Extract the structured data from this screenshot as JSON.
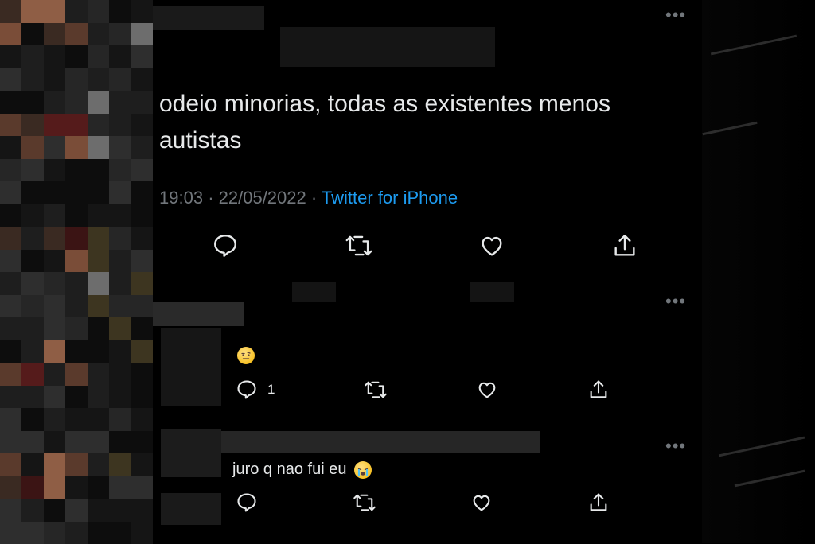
{
  "tweet": {
    "text": "odeio minorias, todas as existentes menos autistas",
    "time": "19:03",
    "date": "22/05/2022",
    "separator": "·",
    "source": "Twitter for iPhone",
    "more_label": "•••"
  },
  "replies": [
    {
      "text": "",
      "emoji": "face-with-raised-eyebrow",
      "reply_count": "1",
      "more_label": "•••"
    },
    {
      "text": "juro q nao fui eu",
      "emoji": "loudly-crying-face",
      "more_label": "•••"
    }
  ],
  "icons": [
    "reply-icon",
    "retweet-icon",
    "like-icon",
    "share-icon",
    "more-icon"
  ],
  "colors": {
    "background": "#000000",
    "text": "#e7e9ea",
    "muted": "#71767b",
    "link": "#1d9bf0"
  }
}
